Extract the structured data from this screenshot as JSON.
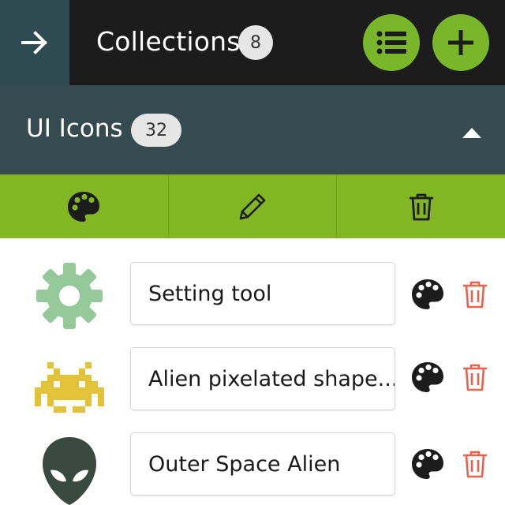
{
  "header": {
    "back_icon": "arrow-right-icon",
    "title": "Collections",
    "count": "8",
    "list_icon": "list-icon",
    "add_icon": "plus-icon"
  },
  "collection": {
    "title": "UI Icons",
    "count": "32",
    "toggle_icon": "caret-up-icon"
  },
  "toolbar": {
    "items": [
      {
        "icon": "palette-icon"
      },
      {
        "icon": "pencil-icon"
      },
      {
        "icon": "trash-icon"
      }
    ]
  },
  "icons": [
    {
      "name": "Setting tool",
      "icon": "gear-icon",
      "color": "#96c99a"
    },
    {
      "name": "Alien pixelated shape...",
      "icon": "space-invader-icon",
      "color": "#e3c33a"
    },
    {
      "name": "Outer Space Alien",
      "icon": "alien-head-icon",
      "color": "#3a4a40"
    }
  ],
  "colors": {
    "header_bg": "#1c1c1c",
    "back_bg": "#2e4b52",
    "accent_green": "#7ab62a",
    "collection_bg": "#354b4f",
    "toolbar_bg": "#82b623",
    "delete_red": "#e8624e"
  }
}
